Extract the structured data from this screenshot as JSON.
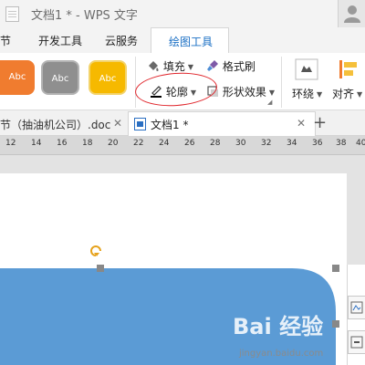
{
  "window": {
    "title": "文档1 * - WPS 文字"
  },
  "menubar": {
    "tabs": [
      {
        "label": "节"
      },
      {
        "label": "开发工具"
      },
      {
        "label": "云服务"
      },
      {
        "label": "绘图工具"
      }
    ],
    "active_tab": "绘图工具"
  },
  "ribbon": {
    "style_swatches": [
      {
        "label": "Abc",
        "color": "#f07c2f"
      },
      {
        "label": "Abc",
        "color": "#8f8f8f"
      },
      {
        "label": "Abc",
        "color": "#f6b900"
      }
    ],
    "fill_label": "填充",
    "format_painter_label": "格式刷",
    "outline_label": "轮廓",
    "shape_effects_label": "形状效果",
    "wrap_label": "环绕",
    "align_label": "对齐"
  },
  "doc_tabs": {
    "inactive_tab_label": "节（抽油机公司）.doc",
    "active_tab_label": "文档1 *"
  },
  "ruler": {
    "numbers": [
      "12",
      "14",
      "16",
      "18",
      "20",
      "22",
      "24",
      "26",
      "28",
      "30",
      "32",
      "34",
      "36",
      "38",
      "40"
    ]
  },
  "watermark": {
    "brand": "Bai 经验",
    "url": "jingyan.baidu.com"
  },
  "colors": {
    "accent_blue": "#1a6fc4",
    "shape_fill": "#5b9bd5",
    "highlight_red": "#e0252b"
  }
}
